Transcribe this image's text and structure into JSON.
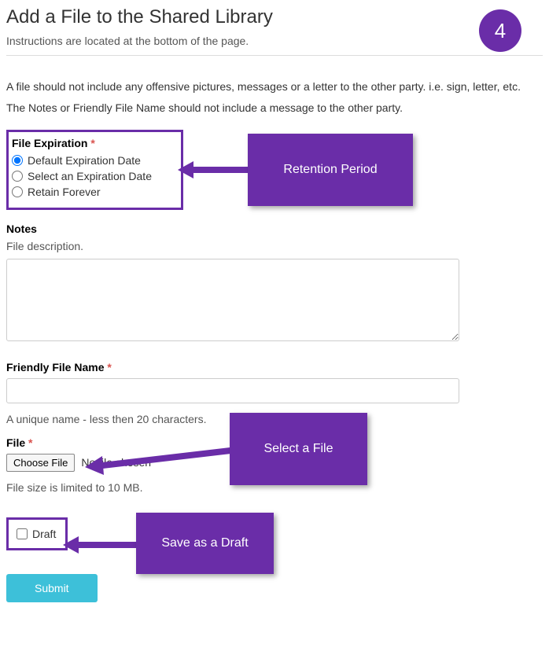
{
  "page": {
    "title": "Add a File to the Shared Library",
    "subtitle": "Instructions are located at the bottom of the page.",
    "step_number": "4"
  },
  "instructions": {
    "line1": "A file should not include any offensive pictures, messages or a letter to the other party. i.e. sign, letter, etc.",
    "line2": "The Notes or Friendly File Name should not include a message to the other party."
  },
  "file_expiration": {
    "label": "File Expiration",
    "required_marker": "*",
    "options": [
      "Default Expiration Date",
      "Select an Expiration Date",
      "Retain Forever"
    ],
    "selected": "Default Expiration Date"
  },
  "notes": {
    "label": "Notes",
    "helper": "File description."
  },
  "friendly_name": {
    "label": "Friendly File Name",
    "required_marker": "*",
    "helper": "A unique name - less then 20 characters."
  },
  "file": {
    "label": "File",
    "required_marker": "*",
    "button_label": "Choose File",
    "status_text": "No file chosen",
    "size_limit": "File size is limited to 10 MB."
  },
  "draft": {
    "label": "Draft"
  },
  "submit": {
    "label": "Submit"
  },
  "callouts": {
    "retention": "Retention Period",
    "select_file": "Select a File",
    "save_draft": "Save as a Draft"
  }
}
